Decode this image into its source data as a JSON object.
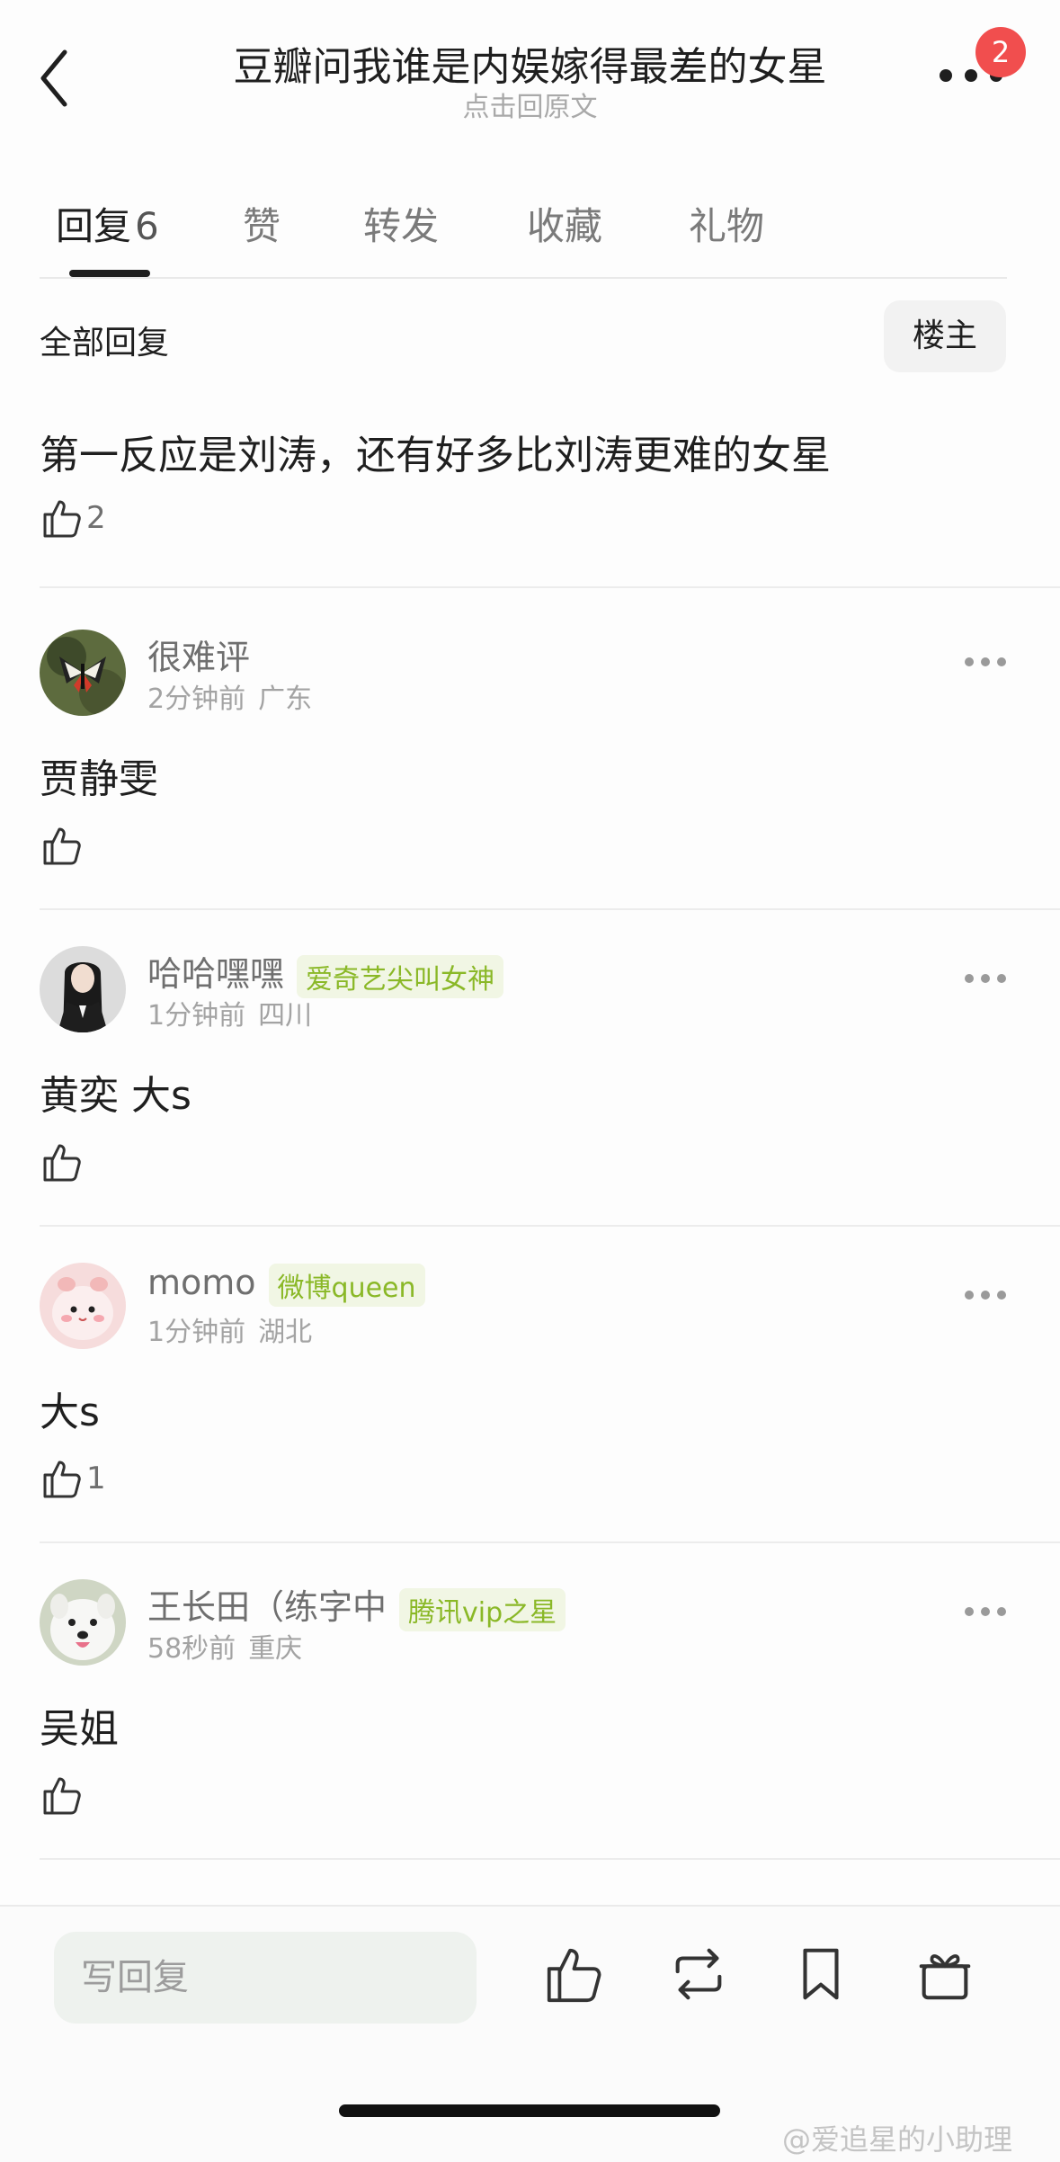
{
  "header": {
    "title": "豆瓣问我谁是内娱嫁得最差的女星",
    "subtitle": "点击回原文",
    "notification_count": "2"
  },
  "tabs": [
    {
      "label": "回复",
      "count": "6"
    },
    {
      "label": "赞"
    },
    {
      "label": "转发"
    },
    {
      "label": "收藏"
    },
    {
      "label": "礼物"
    }
  ],
  "section": {
    "title": "全部回复",
    "op_button": "楼主"
  },
  "comments": [
    {
      "text": "第一反应是刘涛，还有好多比刘涛更难的女星",
      "likes": "2"
    },
    {
      "username": "很难评",
      "tag": "",
      "time": "2分钟前",
      "location": "广东",
      "text": "贾静雯",
      "likes": ""
    },
    {
      "username": "哈哈嘿嘿",
      "tag": "爱奇艺尖叫女神",
      "time": "1分钟前",
      "location": "四川",
      "text": "黄奕 大s",
      "likes": ""
    },
    {
      "username": "momo",
      "tag": "微博queen",
      "time": "1分钟前",
      "location": "湖北",
      "text": "大s",
      "likes": "1"
    },
    {
      "username": "王长田（练字中",
      "tag": "腾讯vip之星",
      "time": "58秒前",
      "location": "重庆",
      "text": "吴姐",
      "likes": ""
    }
  ],
  "bottom": {
    "reply_placeholder": "写回复",
    "watermark": "@爱追星的小助理"
  },
  "colors": {
    "accent_green": "#8ab827",
    "badge_red": "#f14e4e"
  }
}
